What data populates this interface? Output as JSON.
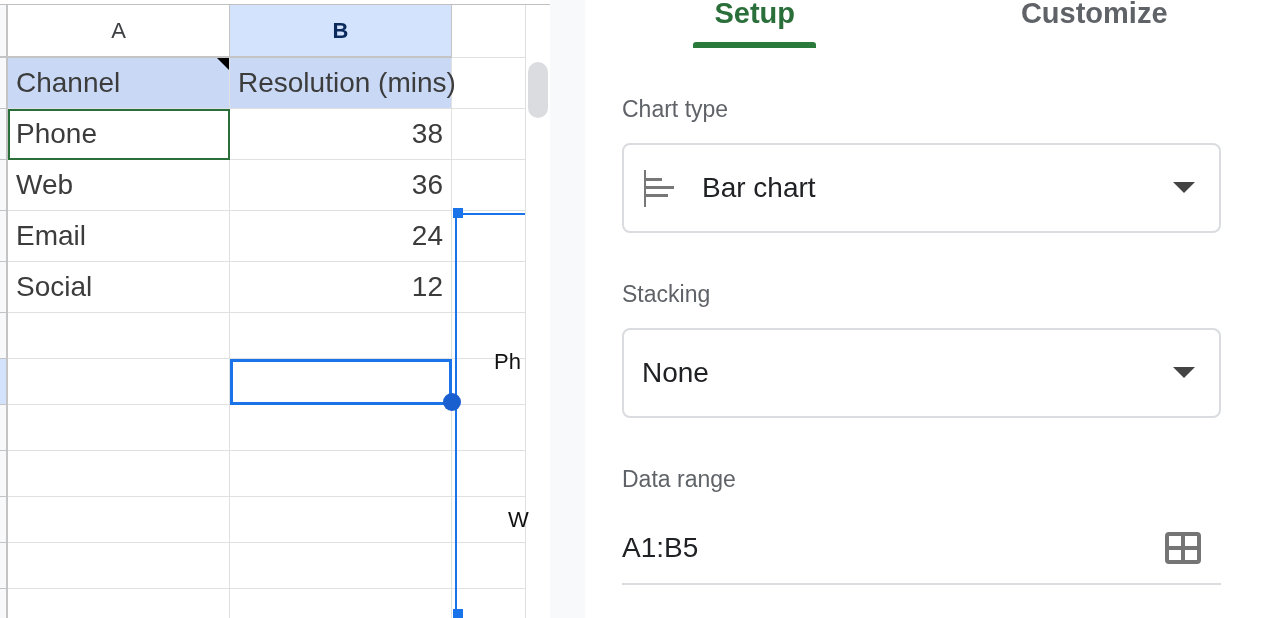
{
  "sheet": {
    "columns": [
      {
        "label": "A",
        "selected": false
      },
      {
        "label": "B",
        "selected": true
      }
    ],
    "rows": [
      {
        "selected": false,
        "cells": [
          {
            "kind": "text",
            "text": "Channel",
            "in_range": true,
            "active": false,
            "focused": false,
            "note": true
          },
          {
            "kind": "text",
            "text": "Resolution (mins)",
            "in_range": true,
            "active": false,
            "focused": false,
            "note": false
          }
        ]
      },
      {
        "selected": false,
        "cells": [
          {
            "kind": "text",
            "text": "Phone",
            "in_range": false,
            "active": true,
            "focused": false,
            "note": false
          },
          {
            "kind": "number",
            "text": "38",
            "in_range": false,
            "active": false,
            "focused": false,
            "note": false
          }
        ]
      },
      {
        "selected": false,
        "cells": [
          {
            "kind": "text",
            "text": "Web",
            "in_range": false,
            "active": false,
            "focused": false,
            "note": false
          },
          {
            "kind": "number",
            "text": "36",
            "in_range": false,
            "active": false,
            "focused": false,
            "note": false
          }
        ]
      },
      {
        "selected": false,
        "cells": [
          {
            "kind": "text",
            "text": "Email",
            "in_range": false,
            "active": false,
            "focused": false,
            "note": false
          },
          {
            "kind": "number",
            "text": "24",
            "in_range": false,
            "active": false,
            "focused": false,
            "note": false
          }
        ]
      },
      {
        "selected": false,
        "cells": [
          {
            "kind": "text",
            "text": "Social",
            "in_range": false,
            "active": false,
            "focused": false,
            "note": false
          },
          {
            "kind": "number",
            "text": "12",
            "in_range": false,
            "active": false,
            "focused": false,
            "note": false
          }
        ]
      },
      {
        "selected": false,
        "cells": [
          {
            "kind": "empty",
            "in_range": false,
            "active": false,
            "focused": false,
            "note": false
          },
          {
            "kind": "empty",
            "in_range": false,
            "active": false,
            "focused": false,
            "note": false
          }
        ]
      },
      {
        "selected": true,
        "cells": [
          {
            "kind": "empty",
            "in_range": false,
            "active": false,
            "focused": false,
            "note": false
          },
          {
            "kind": "empty",
            "in_range": false,
            "active": false,
            "focused": true,
            "note": false
          }
        ]
      },
      {
        "selected": false,
        "cells": [
          {
            "kind": "empty",
            "in_range": false,
            "active": false,
            "focused": false,
            "note": false
          },
          {
            "kind": "empty",
            "in_range": false,
            "active": false,
            "focused": false,
            "note": false
          }
        ]
      },
      {
        "selected": false,
        "cells": [
          {
            "kind": "empty",
            "in_range": false,
            "active": false,
            "focused": false,
            "note": false
          },
          {
            "kind": "empty",
            "in_range": false,
            "active": false,
            "focused": false,
            "note": false
          }
        ]
      },
      {
        "selected": false,
        "cells": [
          {
            "kind": "empty",
            "in_range": false,
            "active": false,
            "focused": false,
            "note": false
          },
          {
            "kind": "empty",
            "in_range": false,
            "active": false,
            "focused": false,
            "note": false
          }
        ]
      },
      {
        "selected": false,
        "cells": [
          {
            "kind": "empty",
            "in_range": false,
            "active": false,
            "focused": false,
            "note": false
          },
          {
            "kind": "empty",
            "in_range": false,
            "active": false,
            "focused": false,
            "note": false
          }
        ]
      },
      {
        "selected": false,
        "cells": [
          {
            "kind": "empty",
            "in_range": false,
            "active": false,
            "focused": false,
            "note": false
          },
          {
            "kind": "empty",
            "in_range": false,
            "active": false,
            "focused": false,
            "note": false
          }
        ]
      }
    ],
    "chart_preview": {
      "labels": [
        "Ph",
        "W"
      ]
    }
  },
  "editor": {
    "tabs": [
      {
        "label": "Setup",
        "selected": true
      },
      {
        "label": "Customize",
        "selected": false
      }
    ],
    "fields": [
      {
        "kind": "dropdown",
        "label": "Chart type",
        "value": "Bar chart"
      },
      {
        "kind": "dropdown",
        "label": "Stacking",
        "value": "None"
      },
      {
        "kind": "range",
        "label": "Data range",
        "value": "A1:B5"
      }
    ]
  }
}
